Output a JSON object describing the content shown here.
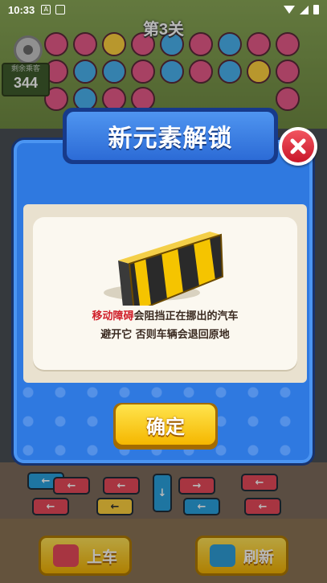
{
  "status_bar": {
    "time": "10:33"
  },
  "game": {
    "level_title": "第3关",
    "remaining_label": "剩余乘客",
    "remaining_count": "344",
    "bottom_buttons": [
      {
        "label": "上车",
        "icon": "board-car-icon"
      },
      {
        "label": "刷新",
        "icon": "refresh-car-icon"
      }
    ]
  },
  "dialog": {
    "title": "新元素解锁",
    "description_highlight": "移动障碍",
    "description_line1_rest": "会阻挡正在挪出的汽车",
    "description_line2": "避开它 否则车辆会退回原地",
    "confirm_label": "确定",
    "close_icon": "close-icon",
    "illustration_icon": "striped-barrier-icon"
  },
  "colors": {
    "dialog_blue": "#2f79e0",
    "highlight_red": "#d0202a",
    "button_yellow": "#f5b700"
  }
}
